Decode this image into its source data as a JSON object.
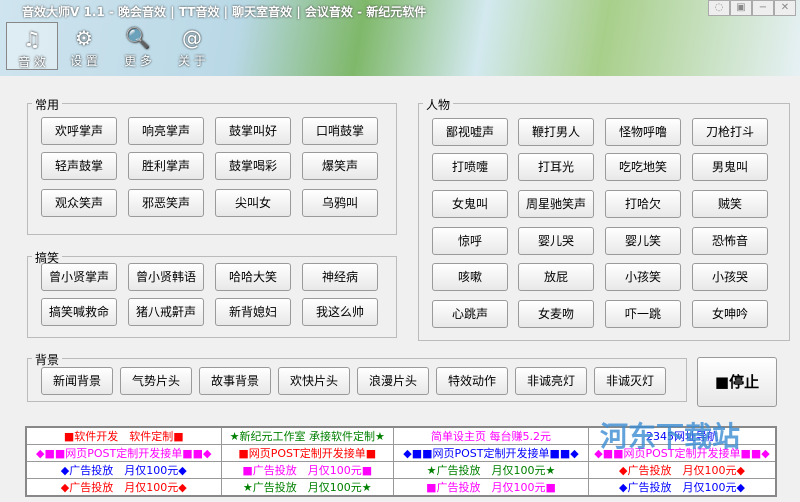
{
  "title": "音效大师V 1.1 - 晚会音效 | TT音效 | 聊天室音效 | 会议音效 - 新纪元软件",
  "toolbar": [
    {
      "label": "音 效",
      "icon": "music-icon"
    },
    {
      "label": "设 置",
      "icon": "gear-icon"
    },
    {
      "label": "更 多",
      "icon": "search-icon"
    },
    {
      "label": "关 于",
      "icon": "at-icon"
    }
  ],
  "groups": {
    "common": {
      "label": "常用",
      "buttons": [
        "欢呼掌声",
        "响亮掌声",
        "鼓掌叫好",
        "口哨鼓掌",
        "轻声鼓掌",
        "胜利掌声",
        "鼓掌喝彩",
        "爆笑声",
        "观众笑声",
        "邪恶笑声",
        "尖叫女",
        "乌鸦叫"
      ]
    },
    "funny": {
      "label": "搞笑",
      "buttons": [
        "曾小贤掌声",
        "曾小贤韩语",
        "哈哈大笑",
        "神经病",
        "搞笑喊救命",
        "猪八戒鼾声",
        "新背媳妇",
        "我这么帅"
      ]
    },
    "people": {
      "label": "人物",
      "buttons": [
        "鄙视嘘声",
        "鞭打男人",
        "怪物呼噜",
        "刀枪打斗",
        "打喷嚏",
        "打耳光",
        "吃吃地笑",
        "男鬼叫",
        "女鬼叫",
        "周星驰笑声",
        "打哈欠",
        "贼笑",
        "惊呼",
        "婴儿哭",
        "婴儿笑",
        "恐怖音",
        "咳嗽",
        "放屁",
        "小孩笑",
        "小孩哭",
        "心跳声",
        "女麦吻",
        "吓一跳",
        "女呻吟"
      ]
    },
    "background": {
      "label": "背景",
      "buttons": [
        "新闻背景",
        "气势片头",
        "故事背景",
        "欢快片头",
        "浪漫片头",
        "特效动作",
        "非诚亮灯",
        "非诚灭灯"
      ]
    }
  },
  "stop_label": "■停止",
  "ads": [
    [
      {
        "t": "■软件开发　软件定制■",
        "c": "#ff0000"
      },
      {
        "t": "★新纪元工作室 承接软件定制★",
        "c": "#008000"
      },
      {
        "t": "简单设主页 每台赚5.2元",
        "c": "#ff00ff"
      },
      {
        "t": "2345网址导航",
        "c": "#0000ff"
      }
    ],
    [
      {
        "t": "◆■■网页POST定制开发接单■■◆",
        "c": "#ff00ff"
      },
      {
        "t": "■网页POST定制开发接单■",
        "c": "#ff0000"
      },
      {
        "t": "◆■■网页POST定制开发接单■■◆",
        "c": "#0000ff"
      },
      {
        "t": "◆■■网页POST定制开发接单■■◆",
        "c": "#ff00ff"
      }
    ],
    [
      {
        "t": "◆广告投放　月仅100元◆",
        "c": "#0000ff"
      },
      {
        "t": "■广告投放　月仅100元■",
        "c": "#ff00ff"
      },
      {
        "t": "★广告投放　月仅100元★",
        "c": "#008000"
      },
      {
        "t": "◆广告投放　月仅100元◆",
        "c": "#ff0000"
      }
    ],
    [
      {
        "t": "◆广告投放　月仅100元◆",
        "c": "#ff0000"
      },
      {
        "t": "★广告投放　月仅100元★",
        "c": "#008000"
      },
      {
        "t": "■广告投放　月仅100元■",
        "c": "#ff00ff"
      },
      {
        "t": "◆广告投放　月仅100元◆",
        "c": "#0000ff"
      }
    ]
  ],
  "watermark": "河东下载站 www.pc0359.cn"
}
